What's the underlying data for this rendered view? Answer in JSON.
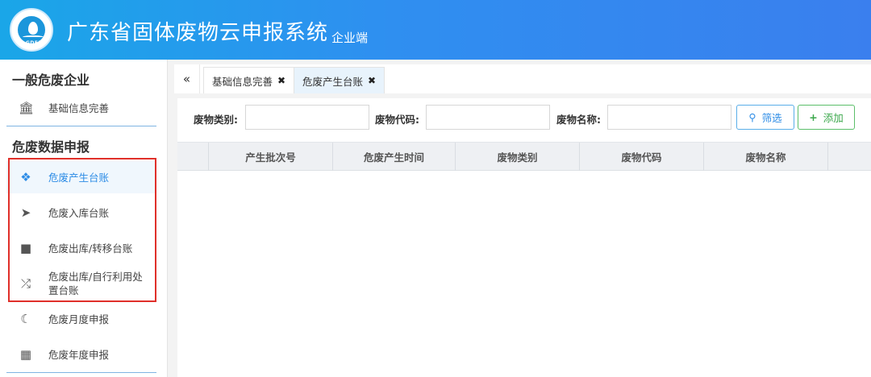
{
  "header": {
    "logo_text": "GDEE",
    "title": "广东省固体废物云申报系统",
    "subtitle": "企业端"
  },
  "sidebar": {
    "group1": {
      "title": "一般危废企业",
      "items": [
        {
          "label": "基础信息完善",
          "icon": "bank-icon"
        }
      ]
    },
    "group2": {
      "title": "危废数据申报",
      "items": [
        {
          "label": "危废产生台账",
          "icon": "cubes-icon",
          "active": true
        },
        {
          "label": "危废入库台账",
          "icon": "rocket-icon"
        },
        {
          "label": "危废出库/转移台账",
          "icon": "truck-icon"
        },
        {
          "label": "危废出库/自行利用处置台账",
          "icon": "shuffle-icon"
        },
        {
          "label": "危废月度申报",
          "icon": "moon-icon"
        },
        {
          "label": "危废年度申报",
          "icon": "calendar-icon"
        }
      ]
    }
  },
  "tabs": {
    "collapse": "«",
    "items": [
      {
        "label": "基础信息完善",
        "close": "✖"
      },
      {
        "label": "危废产生台账",
        "close": "✖",
        "active": true
      }
    ]
  },
  "filters": {
    "category_label": "废物类别:",
    "category_value": "",
    "code_label": "废物代码:",
    "code_value": "",
    "name_label": "废物名称:",
    "name_value": "",
    "filter_button": "筛选",
    "add_button": "添加"
  },
  "table": {
    "columns": [
      "产生批次号",
      "危废产生时间",
      "废物类别",
      "废物代码",
      "废物名称"
    ],
    "rows": []
  },
  "colors": {
    "header_start": "#1aa6e8",
    "header_end": "#3a7fee",
    "accent": "#2d8ce6",
    "add": "#3aa74a",
    "highlight_box": "#e0302a"
  }
}
